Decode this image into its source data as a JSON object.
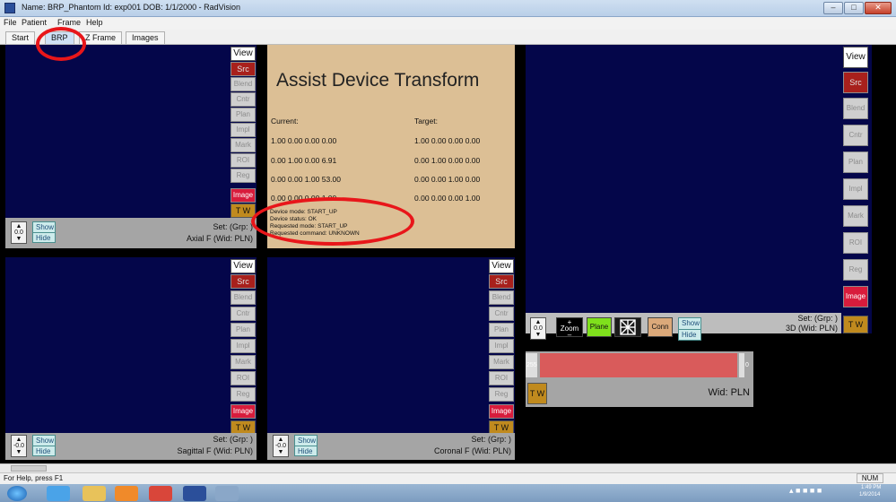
{
  "window": {
    "title": "Name: BRP_Phantom   Id: exp001   DOB: 1/1/2000 - RadVision"
  },
  "menu": [
    "File",
    "Patient",
    "Frame",
    "Help"
  ],
  "tabs": [
    {
      "label": "Start"
    },
    {
      "label": "BRP"
    },
    {
      "label": "Z Frame"
    },
    {
      "label": "Images"
    }
  ],
  "viewport_buttons": {
    "view": "View",
    "src": "Src",
    "blend": "Blend",
    "cntr": "Cntr",
    "plan": "Plan",
    "impl": "Impl",
    "mark": "Mark",
    "roi": "ROI",
    "reg": "Reg",
    "image": "Image",
    "tw": "T W"
  },
  "show_hide": {
    "show": "Show",
    "hide": "Hide"
  },
  "axial": {
    "offset": "0.0",
    "set": "Set:  (Grp: )",
    "name": "Axial F (Wid: PLN)"
  },
  "sagittal": {
    "offset": "-0.0",
    "set": "Set:  (Grp: )",
    "name": "Sagittal F (Wid: PLN)"
  },
  "coronal": {
    "offset": "-0.0",
    "set": "Set:  (Grp: )",
    "name": "Coronal F (Wid: PLN)"
  },
  "view3d": {
    "offset": "0.0",
    "zoom_label": "Zoom",
    "plane_label": "Plane",
    "conn_label": "Conn",
    "set": "Set:  (Grp: )",
    "name": "3D (Wid: PLN)"
  },
  "assist": {
    "title": "Assist Device Transform",
    "current_label": "Current:",
    "target_label": "Target:",
    "current_rows": [
      "1.00  0.00  0.00  0.00",
      "0.00  1.00  0.00  6.91",
      "0.00  0.00  1.00  53.00",
      "0.00  0.00  0.00  1.00"
    ],
    "target_rows": [
      "1.00  0.00  0.00  0.00",
      "0.00  1.00  0.00  0.00",
      "0.00  0.00  1.00  0.00",
      "0.00  0.00  0.00  1.00"
    ],
    "status_lines": [
      "Device mode: START_UP",
      "Device status: OK",
      "Requested mode: START_UP",
      "Requested command: UNKNOWN"
    ]
  },
  "window_level": {
    "min": "255",
    "max": "0",
    "tw": "T W",
    "wid": "Wid: PLN"
  },
  "statusline": {
    "help": "For Help, press F1",
    "num": "NUM"
  },
  "tray": {
    "time": "1:49 PM",
    "date": "1/9/2014"
  },
  "colors": {
    "viewport_bg": "#04064a",
    "assist_bg": "#dcbf95",
    "annotation": "#e8161a",
    "src": "#a8201c",
    "image": "#d81c3c",
    "tw": "#c08a1e"
  }
}
